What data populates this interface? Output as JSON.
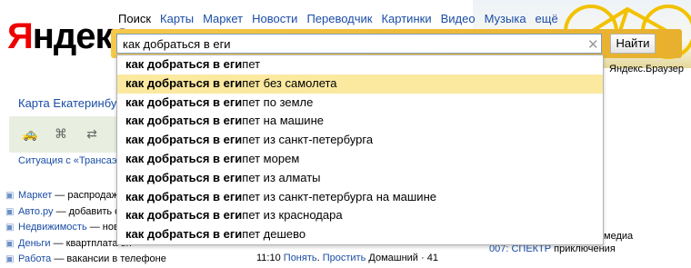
{
  "logo": {
    "first": "Я",
    "rest": "ндекс"
  },
  "nav": [
    "Поиск",
    "Карты",
    "Маркет",
    "Новости",
    "Переводчик",
    "Картинки",
    "Видео",
    "Музыка",
    "ещё"
  ],
  "search": {
    "value": "как добраться в еги",
    "button": "Найти"
  },
  "browser_link": "Яндекс.Браузер",
  "suggestions": {
    "prefix": "как добраться в еги",
    "items": [
      "пет",
      "пет без самолета",
      "пет по земле",
      "пет на машине",
      "пет из санкт-петербурга",
      "пет морем",
      "пет из алматы",
      "пет из санкт-петербурга на машине",
      "пет из краснодара",
      "пет дешево"
    ]
  },
  "map": {
    "title": "Карта Екатеринбу",
    "situation": "Ситуация с «Трансаэро»"
  },
  "services": [
    {
      "name": "Маркет",
      "desc": " — распродажи в"
    },
    {
      "name": "Авто.ру",
      "desc": " — добавить объ"
    },
    {
      "name": "Недвижимость",
      "desc": " — новые"
    },
    {
      "name": "Деньги",
      "desc": " — квартплата он"
    },
    {
      "name": "Работа",
      "desc": " — вакансии в телефоне"
    }
  ],
  "news_line": {
    "time": "11:10",
    "a": "Понять",
    "b": "Простить",
    "c": "Домашний · 41"
  },
  "tv_line": {
    "code": "007: СПЕКТР",
    "desc": " приключения",
    "media": "медиа"
  }
}
